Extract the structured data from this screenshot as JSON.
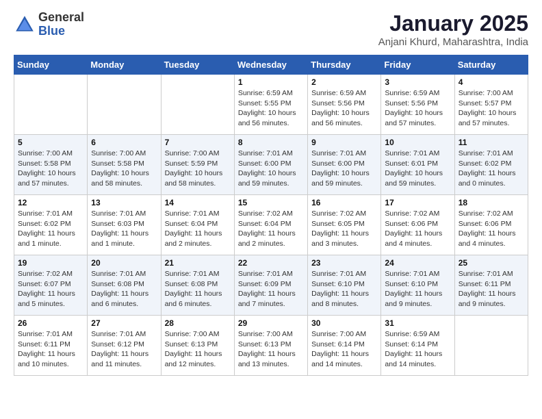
{
  "logo": {
    "general": "General",
    "blue": "Blue"
  },
  "header": {
    "title": "January 2025",
    "subtitle": "Anjani Khurd, Maharashtra, India"
  },
  "days_of_week": [
    "Sunday",
    "Monday",
    "Tuesday",
    "Wednesday",
    "Thursday",
    "Friday",
    "Saturday"
  ],
  "weeks": [
    [
      {
        "day": "",
        "info": ""
      },
      {
        "day": "",
        "info": ""
      },
      {
        "day": "",
        "info": ""
      },
      {
        "day": "1",
        "info": "Sunrise: 6:59 AM\nSunset: 5:55 PM\nDaylight: 10 hours and 56 minutes."
      },
      {
        "day": "2",
        "info": "Sunrise: 6:59 AM\nSunset: 5:56 PM\nDaylight: 10 hours and 56 minutes."
      },
      {
        "day": "3",
        "info": "Sunrise: 6:59 AM\nSunset: 5:56 PM\nDaylight: 10 hours and 57 minutes."
      },
      {
        "day": "4",
        "info": "Sunrise: 7:00 AM\nSunset: 5:57 PM\nDaylight: 10 hours and 57 minutes."
      }
    ],
    [
      {
        "day": "5",
        "info": "Sunrise: 7:00 AM\nSunset: 5:58 PM\nDaylight: 10 hours and 57 minutes."
      },
      {
        "day": "6",
        "info": "Sunrise: 7:00 AM\nSunset: 5:58 PM\nDaylight: 10 hours and 58 minutes."
      },
      {
        "day": "7",
        "info": "Sunrise: 7:00 AM\nSunset: 5:59 PM\nDaylight: 10 hours and 58 minutes."
      },
      {
        "day": "8",
        "info": "Sunrise: 7:01 AM\nSunset: 6:00 PM\nDaylight: 10 hours and 59 minutes."
      },
      {
        "day": "9",
        "info": "Sunrise: 7:01 AM\nSunset: 6:00 PM\nDaylight: 10 hours and 59 minutes."
      },
      {
        "day": "10",
        "info": "Sunrise: 7:01 AM\nSunset: 6:01 PM\nDaylight: 10 hours and 59 minutes."
      },
      {
        "day": "11",
        "info": "Sunrise: 7:01 AM\nSunset: 6:02 PM\nDaylight: 11 hours and 0 minutes."
      }
    ],
    [
      {
        "day": "12",
        "info": "Sunrise: 7:01 AM\nSunset: 6:02 PM\nDaylight: 11 hours and 1 minute."
      },
      {
        "day": "13",
        "info": "Sunrise: 7:01 AM\nSunset: 6:03 PM\nDaylight: 11 hours and 1 minute."
      },
      {
        "day": "14",
        "info": "Sunrise: 7:01 AM\nSunset: 6:04 PM\nDaylight: 11 hours and 2 minutes."
      },
      {
        "day": "15",
        "info": "Sunrise: 7:02 AM\nSunset: 6:04 PM\nDaylight: 11 hours and 2 minutes."
      },
      {
        "day": "16",
        "info": "Sunrise: 7:02 AM\nSunset: 6:05 PM\nDaylight: 11 hours and 3 minutes."
      },
      {
        "day": "17",
        "info": "Sunrise: 7:02 AM\nSunset: 6:06 PM\nDaylight: 11 hours and 4 minutes."
      },
      {
        "day": "18",
        "info": "Sunrise: 7:02 AM\nSunset: 6:06 PM\nDaylight: 11 hours and 4 minutes."
      }
    ],
    [
      {
        "day": "19",
        "info": "Sunrise: 7:02 AM\nSunset: 6:07 PM\nDaylight: 11 hours and 5 minutes."
      },
      {
        "day": "20",
        "info": "Sunrise: 7:01 AM\nSunset: 6:08 PM\nDaylight: 11 hours and 6 minutes."
      },
      {
        "day": "21",
        "info": "Sunrise: 7:01 AM\nSunset: 6:08 PM\nDaylight: 11 hours and 6 minutes."
      },
      {
        "day": "22",
        "info": "Sunrise: 7:01 AM\nSunset: 6:09 PM\nDaylight: 11 hours and 7 minutes."
      },
      {
        "day": "23",
        "info": "Sunrise: 7:01 AM\nSunset: 6:10 PM\nDaylight: 11 hours and 8 minutes."
      },
      {
        "day": "24",
        "info": "Sunrise: 7:01 AM\nSunset: 6:10 PM\nDaylight: 11 hours and 9 minutes."
      },
      {
        "day": "25",
        "info": "Sunrise: 7:01 AM\nSunset: 6:11 PM\nDaylight: 11 hours and 9 minutes."
      }
    ],
    [
      {
        "day": "26",
        "info": "Sunrise: 7:01 AM\nSunset: 6:11 PM\nDaylight: 11 hours and 10 minutes."
      },
      {
        "day": "27",
        "info": "Sunrise: 7:01 AM\nSunset: 6:12 PM\nDaylight: 11 hours and 11 minutes."
      },
      {
        "day": "28",
        "info": "Sunrise: 7:00 AM\nSunset: 6:13 PM\nDaylight: 11 hours and 12 minutes."
      },
      {
        "day": "29",
        "info": "Sunrise: 7:00 AM\nSunset: 6:13 PM\nDaylight: 11 hours and 13 minutes."
      },
      {
        "day": "30",
        "info": "Sunrise: 7:00 AM\nSunset: 6:14 PM\nDaylight: 11 hours and 14 minutes."
      },
      {
        "day": "31",
        "info": "Sunrise: 6:59 AM\nSunset: 6:14 PM\nDaylight: 11 hours and 14 minutes."
      },
      {
        "day": "",
        "info": ""
      }
    ]
  ]
}
